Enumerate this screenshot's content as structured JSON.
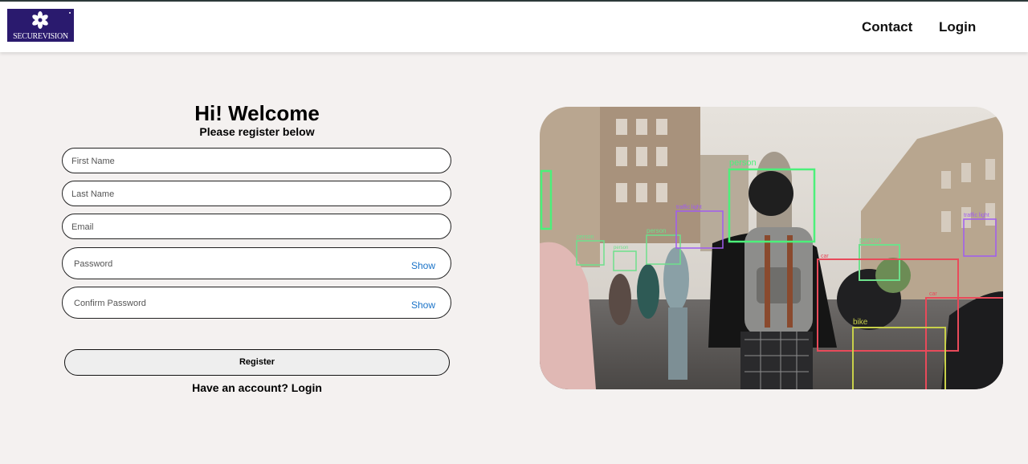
{
  "header": {
    "logo_text": "SECUREVISION",
    "nav": {
      "contact": "Contact",
      "login": "Login"
    }
  },
  "form": {
    "title": "Hi! Welcome",
    "subtitle": "Please register below",
    "fields": {
      "first_name": {
        "placeholder": "First Name",
        "value": ""
      },
      "last_name": {
        "placeholder": "Last Name",
        "value": ""
      },
      "email": {
        "placeholder": "Email",
        "value": ""
      },
      "password": {
        "placeholder": "Password",
        "value": "",
        "toggle": "Show"
      },
      "confirm_password": {
        "placeholder": "Confirm Password",
        "value": "",
        "toggle": "Show"
      }
    },
    "register_label": "Register",
    "account_prompt": "Have an account?",
    "login_link": "Login"
  },
  "hero": {
    "detections": [
      {
        "label": "person",
        "color": "#4cf07a"
      },
      {
        "label": "person",
        "color": "#6ee08c"
      },
      {
        "label": "person",
        "color": "#6ee08c"
      },
      {
        "label": "person",
        "color": "#6ee08c"
      },
      {
        "label": "person",
        "color": "#6ee08c"
      },
      {
        "label": "traffic light",
        "color": "#a05cf0"
      },
      {
        "label": "traffic light",
        "color": "#a05cf0"
      },
      {
        "label": "bike",
        "color": "#c8d04a"
      },
      {
        "label": "car",
        "color": "#e84a5a"
      },
      {
        "label": "car",
        "color": "#e84a5a"
      }
    ]
  },
  "colors": {
    "page_bg": "#f4f1f0",
    "logo_bg": "#2a1a6e",
    "link_blue": "#1a73c8"
  }
}
